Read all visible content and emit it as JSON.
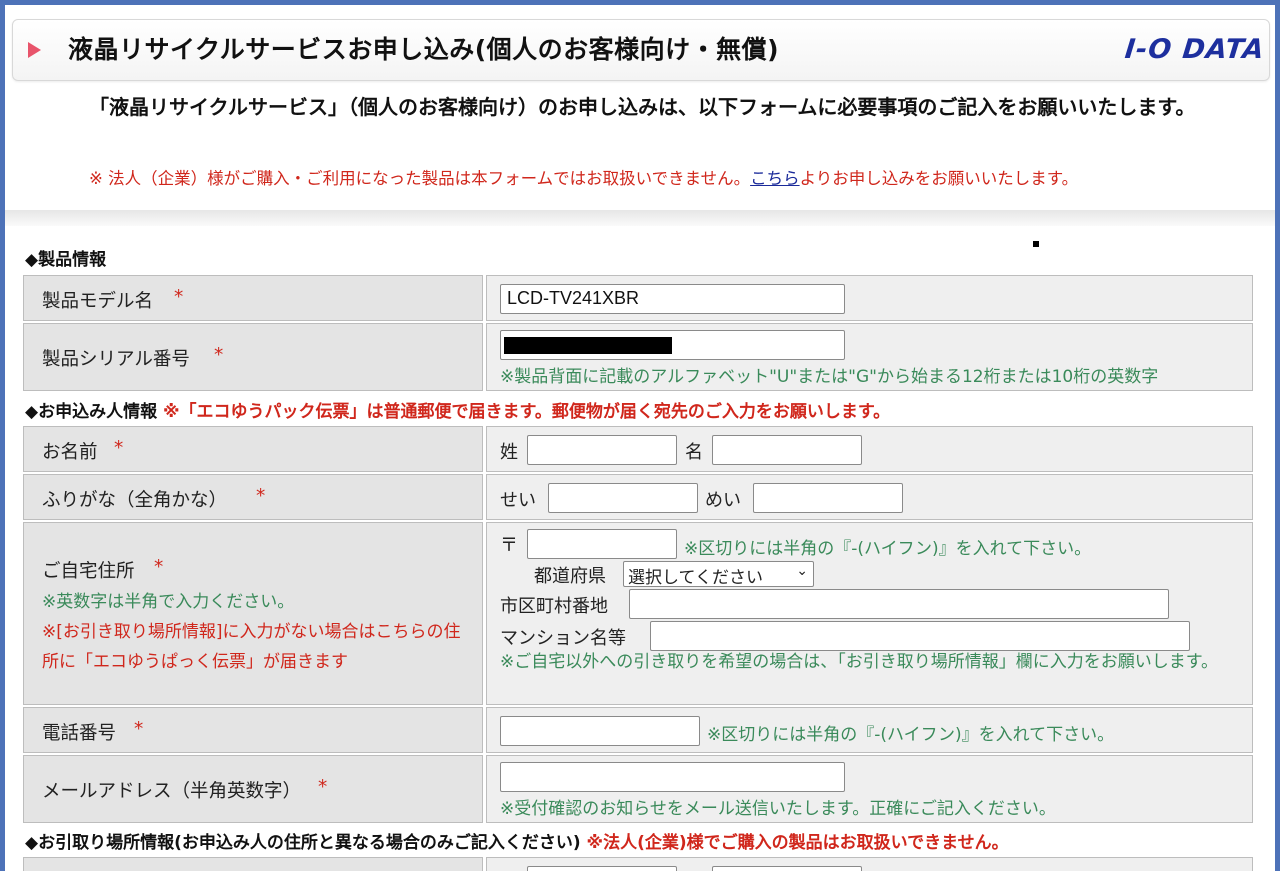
{
  "header": {
    "title": "液晶リサイクルサービスお申し込み(個人のお客様向け・無償)",
    "logo": "I-O DATA",
    "intro": "「液晶リサイクルサービス」（個人のお客様向け）のお申し込みは、以下フォームに必要事項のご記入をお願いいたします。",
    "notice_pre": "※ 法人（企業）様がご購入・ご利用になった製品は本フォームではお取扱いできません。",
    "notice_link": "こちら",
    "notice_post": "よりお申し込みをお願いいたします。"
  },
  "product_section": {
    "title": "◆製品情報",
    "model_label": "製品モデル名",
    "model_value": "LCD-TV241XBR",
    "serial_label": "製品シリアル番号",
    "serial_hint": "※製品背面に記載のアルファベット\"U\"または\"G\"から始まる12桁または10桁の英数字"
  },
  "applicant_section": {
    "title": "◆お申込み人情報",
    "title_note": "※「エコゆうパック伝票」は普通郵便で届きます。郵便物が届く宛先のご入力をお願いします。",
    "name_label": "お名前",
    "sei_label": "姓",
    "mei_label": "名",
    "furigana_label": "ふりがな（全角かな）",
    "sei_kana_label": "せい",
    "mei_kana_label": "めい",
    "address_label": "ご自宅住所",
    "address_note1": "※英数字は半角で入力ください。",
    "address_note2": "※[お引き取り場所情報]に入力がない場合はこちらの住所に「エコゆうぱっく伝票」が届きます",
    "postal_mark": "〒",
    "postal_hint": "※区切りには半角の『-(ハイフン)』を入れて下さい。",
    "prefecture_label": "都道府県",
    "prefecture_select": "選択してください",
    "city_label": "市区町村番地",
    "building_label": "マンション名等",
    "address_hint": "※ご自宅以外への引き取りを希望の場合は、「お引き取り場所情報」欄に入力をお願いします。",
    "phone_label": "電話番号",
    "phone_hint": "※区切りには半角の『-(ハイフン)』を入れて下さい。",
    "email_label": "メールアドレス（半角英数字）",
    "email_hint": "※受付確認のお知らせをメール送信いたします。正確にご記入ください。"
  },
  "pickup_section": {
    "title": "◆お引取り場所情報(お申込み人の住所と異なる場合のみご記入ください)",
    "title_note": "※法人(企業)様でご購入の製品はお取扱いできません。"
  },
  "required_mark": "*"
}
